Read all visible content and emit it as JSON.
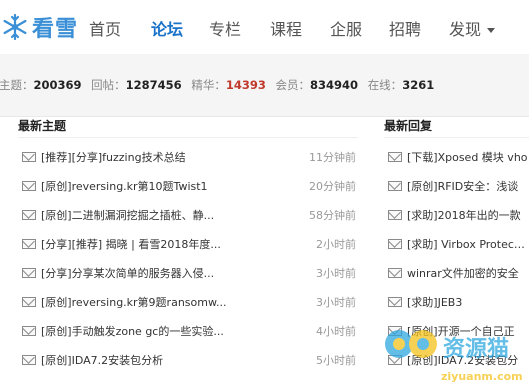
{
  "brand": {
    "name": "看雪"
  },
  "nav": {
    "items": [
      {
        "label": "首页"
      },
      {
        "label": "论坛"
      },
      {
        "label": "专栏"
      },
      {
        "label": "课程"
      },
      {
        "label": "企服"
      },
      {
        "label": "招聘"
      },
      {
        "label": "发现"
      }
    ]
  },
  "stats": {
    "topics_label": "主题：",
    "topics": "200369",
    "replies_label": "回帖：",
    "replies": "1287456",
    "featured_label": "精华：",
    "featured": "14393",
    "members_label": "会员：",
    "members": "834940",
    "online_label": "在线：",
    "online": "3261"
  },
  "latest_topics": {
    "title": "最新主题",
    "rows": [
      {
        "title": "[推荐][分享]fuzzing技术总结",
        "time": "11分钟前"
      },
      {
        "title": "[原创]reversing.kr第10题Twist1",
        "time": "20分钟前"
      },
      {
        "title": "[原创]二进制漏洞挖掘之插桩、静...",
        "time": "58分钟前"
      },
      {
        "title": "[分享][推荐] 揭晓 | 看雪2018年度...",
        "time": "2小时前"
      },
      {
        "title": "[分享]分享某次简单的服务器入侵...",
        "time": "3小时前"
      },
      {
        "title": "[原创]reversing.kr第9题ransomw...",
        "time": "3小时前"
      },
      {
        "title": "[原创]手动触发zone gc的一些实验...",
        "time": "4小时前"
      },
      {
        "title": "[原创]IDA7.2安装包分析",
        "time": "5小时前"
      }
    ]
  },
  "latest_replies": {
    "title": "最新回复",
    "rows": [
      {
        "title": "[下载]Xposed 模块 vho"
      },
      {
        "title": "[原创]RFID安全：浅谈"
      },
      {
        "title": "[求助]2018年出的一款"
      },
      {
        "title": "[求助] Virbox Protector"
      },
      {
        "title": "winrar文件加密的安全"
      },
      {
        "title": "[求助]JEB3"
      },
      {
        "title": "[原创]开源一个自己正"
      },
      {
        "title": "[原创]IDA7.2安装包分"
      }
    ]
  },
  "watermark": {
    "text": "资源猫",
    "subtext": "ziyuanm.com"
  },
  "colors": {
    "brand": "#3a8fd6",
    "active_nav": "#1a73c8",
    "featured": "#c0392b"
  }
}
